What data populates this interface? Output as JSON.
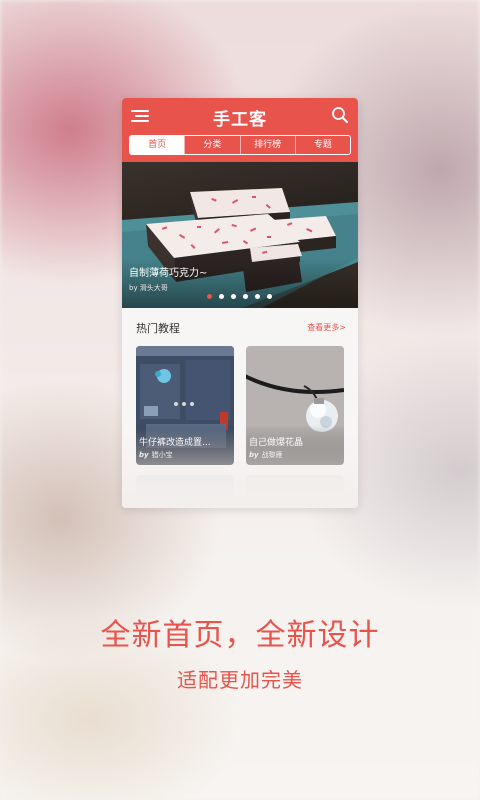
{
  "app": {
    "title": "手工客"
  },
  "tabs": [
    {
      "label": "首页",
      "active": true
    },
    {
      "label": "分类",
      "active": false
    },
    {
      "label": "排行榜",
      "active": false
    },
    {
      "label": "专题",
      "active": false
    }
  ],
  "banner": {
    "title": "自制薄荷巧克力~",
    "author": "by 滑头大哥",
    "slide_count": 6,
    "active_slide": 1
  },
  "section": {
    "title": "热门教程",
    "more_label": "查看更多>"
  },
  "cards": [
    {
      "title": "牛仔裤改造成置...",
      "by": "by",
      "author": "猎小宝"
    },
    {
      "title": "自己做爆花晶",
      "by": "by",
      "author": "战黎雁"
    }
  ],
  "promo": {
    "headline": "全新首页，全新设计",
    "subline": "适配更加完美"
  },
  "colors": {
    "accent": "#e8534c",
    "white": "#ffffff"
  },
  "icons": {
    "menu": "menu-icon",
    "search": "search-icon"
  }
}
